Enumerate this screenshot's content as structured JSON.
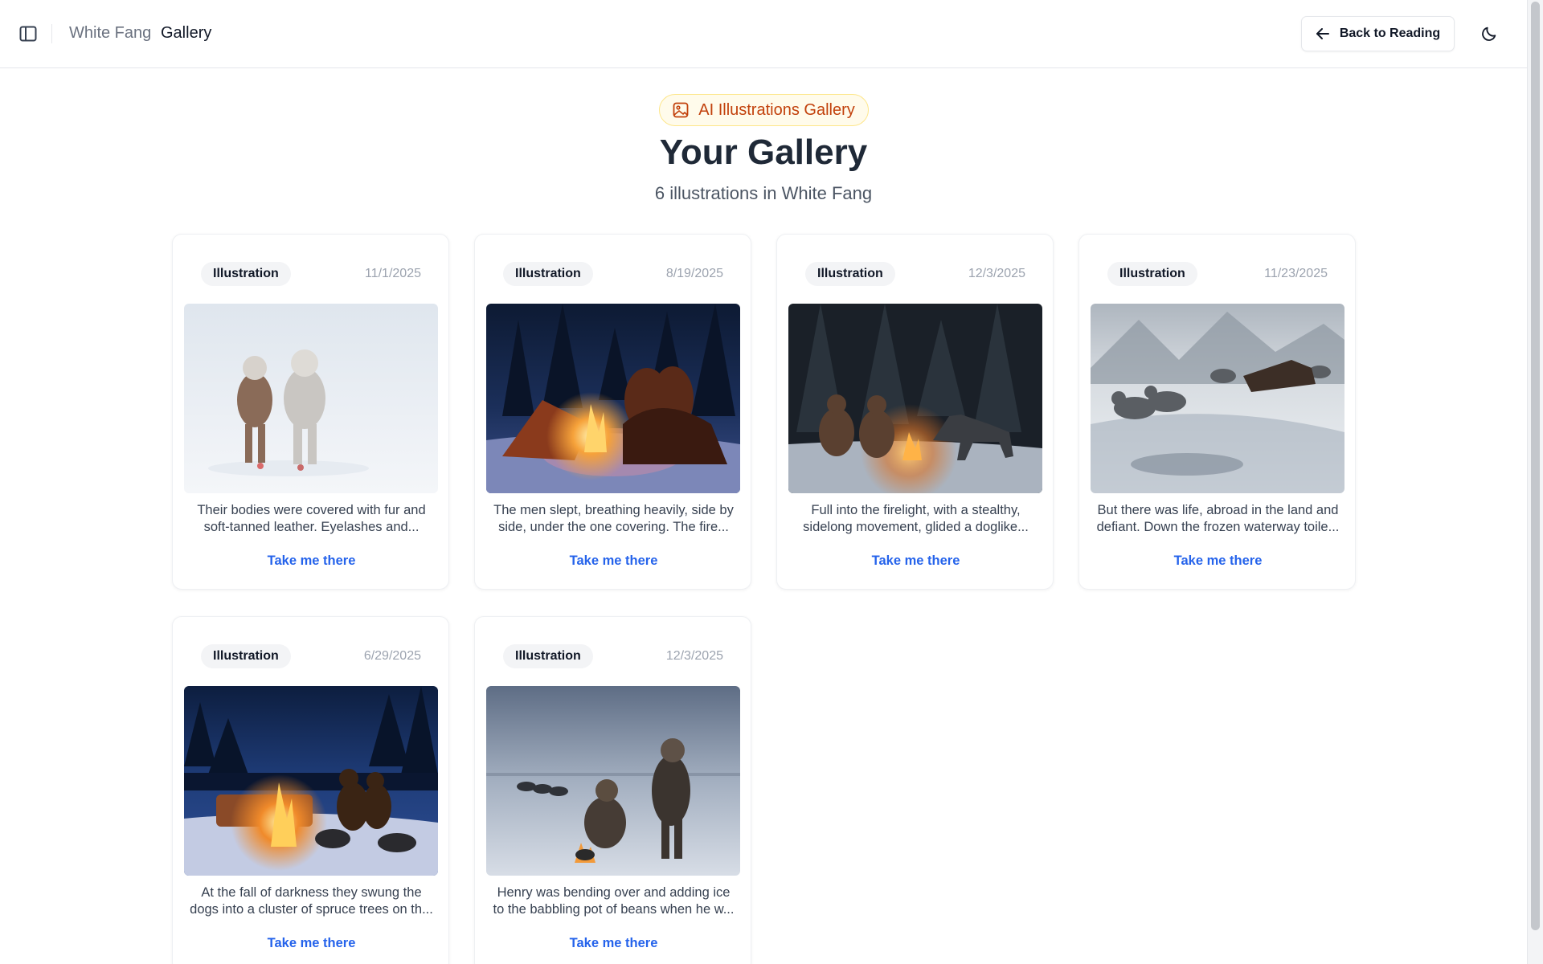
{
  "header": {
    "book": "White Fang",
    "current": "Gallery",
    "back_label": "Back to Reading"
  },
  "hero": {
    "badge": "AI Illustrations Gallery",
    "title": "Your Gallery",
    "subtitle": "6 illustrations in White Fang"
  },
  "cards": [
    {
      "tag": "Illustration",
      "date": "11/1/2025",
      "caption_line1": "Their bodies were covered with fur and",
      "caption_line2": "soft-tanned leather. Eyelashes and...",
      "link": "Take me there"
    },
    {
      "tag": "Illustration",
      "date": "8/19/2025",
      "caption_line1": "The men slept, breathing heavily, side by",
      "caption_line2": "side, under the one covering. The fire...",
      "link": "Take me there"
    },
    {
      "tag": "Illustration",
      "date": "12/3/2025",
      "caption_line1": "Full into the firelight, with a stealthy,",
      "caption_line2": "sidelong movement, glided a doglike...",
      "link": "Take me there"
    },
    {
      "tag": "Illustration",
      "date": "11/23/2025",
      "caption_line1": "But there was life, abroad in the land and",
      "caption_line2": "defiant. Down the frozen waterway toile...",
      "link": "Take me there"
    },
    {
      "tag": "Illustration",
      "date": "6/29/2025",
      "caption_line1": "At the fall of darkness they swung the",
      "caption_line2": "dogs into a cluster of spruce trees on th...",
      "link": "Take me there"
    },
    {
      "tag": "Illustration",
      "date": "12/3/2025",
      "caption_line1": "Henry was bending over and adding ice",
      "caption_line2": "to the babbling pot of beans when he w...",
      "link": "Take me there"
    }
  ],
  "icons": {
    "sidebar_toggle": "sidebar-panel-icon",
    "back": "arrow-left-icon",
    "theme": "moon-icon",
    "badge": "image-icon"
  },
  "colors": {
    "accent_link": "#2563eb",
    "badge_text": "#c2410c",
    "badge_bg": "#fffbeb",
    "badge_border": "#fde68a"
  }
}
